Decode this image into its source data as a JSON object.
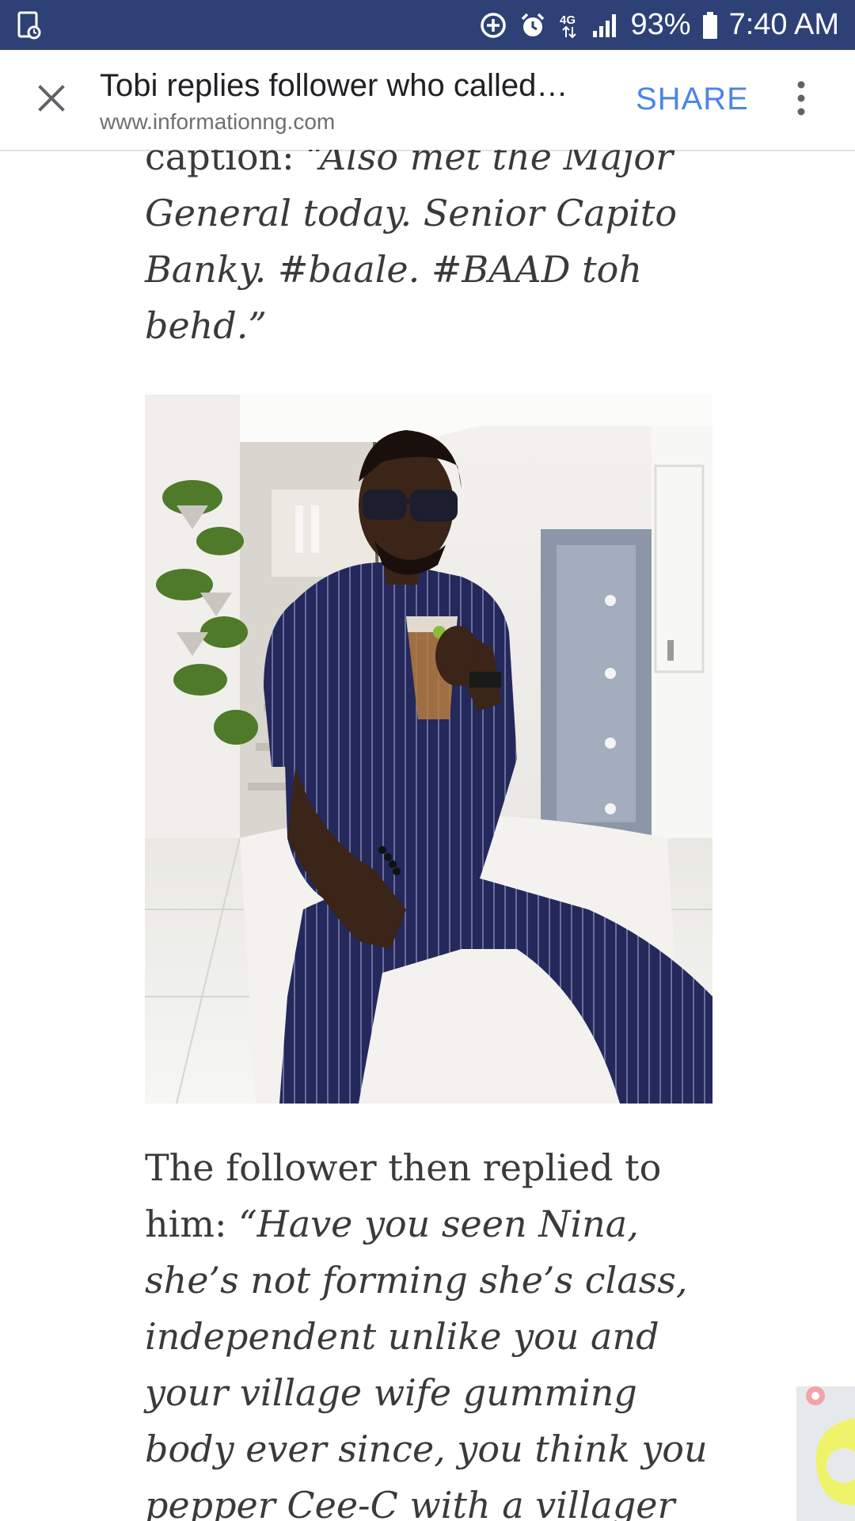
{
  "status_bar": {
    "network": "4G",
    "battery": "93%",
    "time": "7:40 AM",
    "icons": [
      "screenshot-icon",
      "data-saver-icon",
      "alarm-icon",
      "network-4g-icon",
      "signal-icon",
      "battery-icon"
    ]
  },
  "toolbar": {
    "title": "Tobi replies follower who called…",
    "url": "www.informationng.com",
    "share_label": "SHARE",
    "close_icon": "close-icon",
    "more_icon": "more-vert-icon",
    "accent_color": "#4a86e8"
  },
  "article": {
    "caption_prefix": "caption: ",
    "caption_quote": "“Also met the Major General today. Senior Capito Banky. #baale. #BAAD toh behd.”",
    "photo_subject": "man-in-pinstripe-outfit-photo",
    "reply_prefix": "The follower then replied to him: ",
    "reply_quote": "“Have you seen Nina, she’s not forming she’s class, independent unlike you and your village wife gumming body ever since, you think you pepper Cee-C with a villager Nsuka"
  },
  "colors": {
    "status_bar": "#2d4177",
    "text": "#3a3a3a",
    "title": "#202124",
    "url": "#6f6f6f"
  }
}
